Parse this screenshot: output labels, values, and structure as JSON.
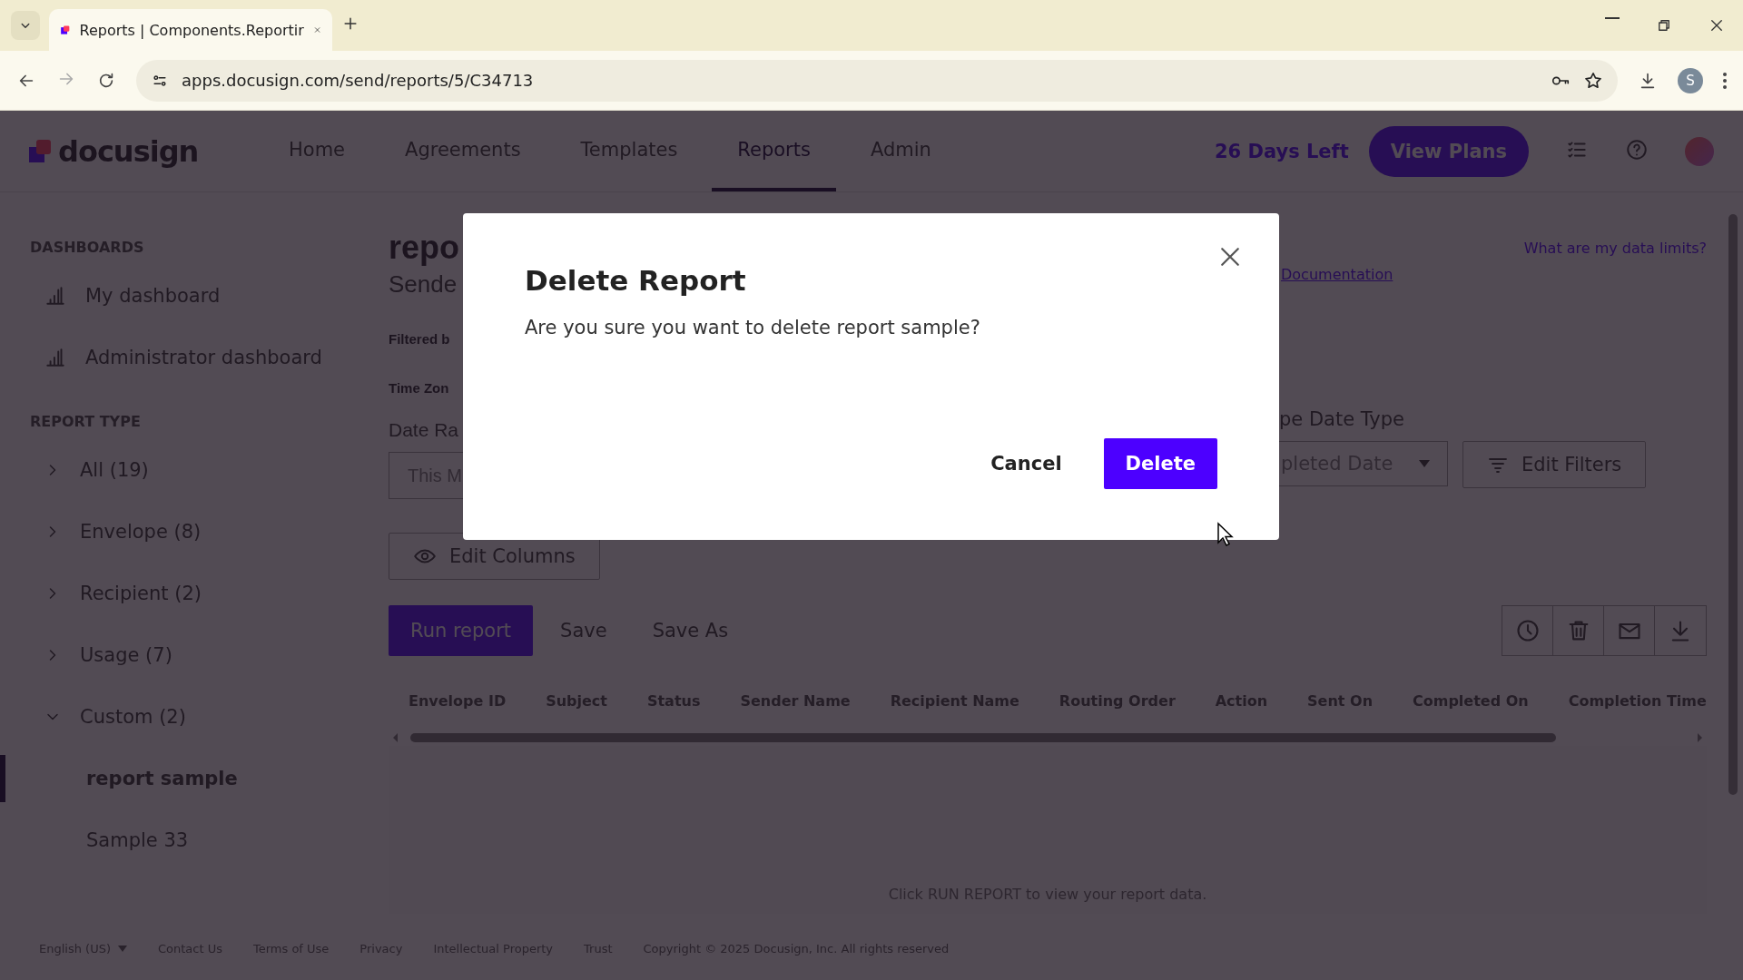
{
  "browser": {
    "tab_title": "Reports | Components.Reportir",
    "url": "apps.docusign.com/send/reports/5/C34713",
    "profile_initial": "S"
  },
  "app": {
    "logo": "docusign",
    "nav": [
      {
        "label": "Home",
        "selected": false
      },
      {
        "label": "Agreements",
        "selected": false
      },
      {
        "label": "Templates",
        "selected": false
      },
      {
        "label": "Reports",
        "selected": true
      },
      {
        "label": "Admin",
        "selected": false
      }
    ],
    "trial": "26 Days Left",
    "plans_button": "View Plans"
  },
  "sidebar": {
    "dashboards_title": "DASHBOARDS",
    "dashboards": [
      {
        "label": "My dashboard",
        "selected": false
      },
      {
        "label": "Administrator dashboard",
        "selected": false
      }
    ],
    "report_type_title": "REPORT TYPE",
    "report_types": [
      {
        "label": "All (19)",
        "expanded": false
      },
      {
        "label": "Envelope (8)",
        "expanded": false
      },
      {
        "label": "Recipient (2)",
        "expanded": false
      },
      {
        "label": "Usage (7)",
        "expanded": false
      },
      {
        "label": "Custom (2)",
        "expanded": true,
        "children": [
          {
            "label": "report sample",
            "selected": true
          },
          {
            "label": "Sample 33",
            "selected": false
          }
        ]
      }
    ]
  },
  "main": {
    "title": "repo",
    "subtitle": "Sende",
    "filtered_label": "Filtered b",
    "timezone_label": "Time Zon",
    "date_range_label": "Date Ra",
    "date_range_value": "This M",
    "data_limits_link": "What are my data limits?",
    "documentation_link": "Documentation",
    "date_type_label": "pe Date Type",
    "date_type_value": "pleted Date",
    "edit_filters": "Edit Filters",
    "edit_columns": "Edit Columns",
    "actions": [
      {
        "label": "Run report",
        "kind": "primary"
      },
      {
        "label": "Save",
        "kind": "text"
      },
      {
        "label": "Save As",
        "kind": "text"
      }
    ],
    "table": {
      "columns": [
        "Envelope ID",
        "Subject",
        "Status",
        "Sender Name",
        "Recipient Name",
        "Routing Order",
        "Action",
        "Sent On",
        "Completed On",
        "Completion Time"
      ],
      "empty_message": "Click RUN REPORT to view your report data."
    }
  },
  "footer": {
    "language": "English (US)",
    "links": [
      "Contact Us",
      "Terms of Use",
      "Privacy",
      "Intellectual Property",
      "Trust"
    ],
    "copyright": "Copyright © 2025 Docusign, Inc. All rights reserved"
  },
  "dialog": {
    "title": "Delete Report",
    "message": "Are you sure you want to delete report sample?",
    "buttons": [
      {
        "label": "Cancel",
        "kind": "secondary"
      },
      {
        "label": "Delete",
        "kind": "primary"
      }
    ]
  }
}
